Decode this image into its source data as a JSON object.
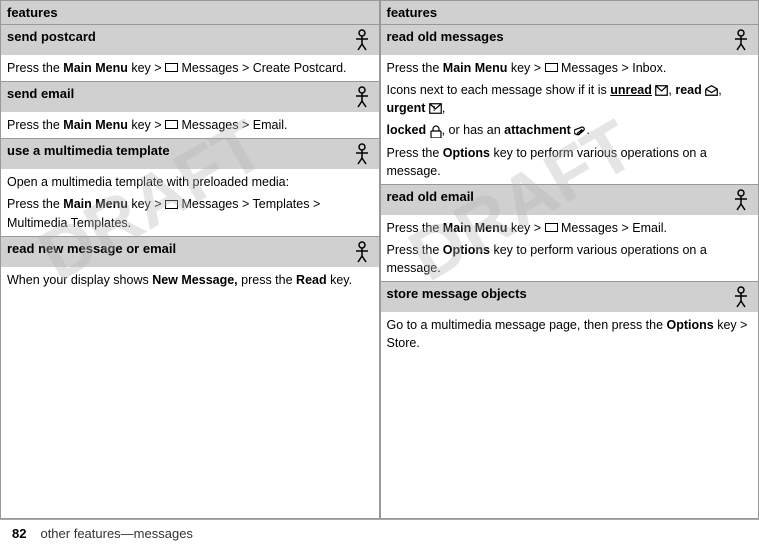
{
  "footer": {
    "page_number": "82",
    "page_text": "other features—messages"
  },
  "columns": [
    {
      "header": "features",
      "sections": [
        {
          "type": "header",
          "title": "send postcard",
          "has_icon": true,
          "body": [
            {
              "type": "text_with_bold",
              "parts": [
                {
                  "text": "Press the ",
                  "bold": false
                },
                {
                  "text": "Main Menu",
                  "bold": true
                },
                {
                  "text": " key > ",
                  "bold": false
                },
                {
                  "text": "M",
                  "bold": false,
                  "icon": "envelope"
                },
                {
                  "text": " Messages > Create Postcard.",
                  "bold": false
                }
              ]
            }
          ]
        },
        {
          "type": "header",
          "title": "send email",
          "has_icon": true,
          "body": [
            {
              "type": "text_with_bold",
              "parts": [
                {
                  "text": "Press the ",
                  "bold": false
                },
                {
                  "text": "Main Menu",
                  "bold": true
                },
                {
                  "text": " key > ",
                  "bold": false
                },
                {
                  "text": "M",
                  "bold": false,
                  "icon": "envelope"
                },
                {
                  "text": " Messages > Email.",
                  "bold": false
                }
              ]
            }
          ]
        },
        {
          "type": "header",
          "title": "use a multimedia template",
          "has_icon": true,
          "body": [
            {
              "type": "plain",
              "text": "Open a multimedia template with preloaded media:"
            },
            {
              "type": "text_with_bold",
              "parts": [
                {
                  "text": "Press the ",
                  "bold": false
                },
                {
                  "text": "Main Menu",
                  "bold": true
                },
                {
                  "text": " key > ",
                  "bold": false
                },
                {
                  "text": "M",
                  "bold": false,
                  "icon": "envelope"
                },
                {
                  "text": " Messages > Templates > Multimedia Templates.",
                  "bold": false
                }
              ]
            }
          ]
        },
        {
          "type": "header",
          "title": "read new message or email",
          "has_icon": true,
          "body": [
            {
              "type": "text_with_bold",
              "parts": [
                {
                  "text": "When your display shows ",
                  "bold": false
                },
                {
                  "text": "New Message,",
                  "bold": true
                },
                {
                  "text": " press the ",
                  "bold": false
                },
                {
                  "text": "Read",
                  "bold": true
                },
                {
                  "text": " key.",
                  "bold": false
                }
              ]
            }
          ]
        }
      ]
    },
    {
      "header": "features",
      "sections": [
        {
          "type": "header",
          "title": "read old messages",
          "has_icon": true,
          "body": [
            {
              "type": "text_with_bold",
              "parts": [
                {
                  "text": "Press the ",
                  "bold": false
                },
                {
                  "text": "Main Menu",
                  "bold": true
                },
                {
                  "text": " key > ",
                  "bold": false
                },
                {
                  "text": "M",
                  "bold": false,
                  "icon": "envelope"
                },
                {
                  "text": " Messages > Inbox.",
                  "bold": false
                }
              ]
            },
            {
              "type": "mixed_icons",
              "content": "icons_msg_row"
            }
          ]
        },
        {
          "type": "header",
          "title": "read old email",
          "has_icon": true,
          "body": [
            {
              "type": "text_with_bold",
              "parts": [
                {
                  "text": "Press the ",
                  "bold": false
                },
                {
                  "text": "Main Menu",
                  "bold": true
                },
                {
                  "text": " key > ",
                  "bold": false
                },
                {
                  "text": "M",
                  "bold": false,
                  "icon": "envelope"
                },
                {
                  "text": " Messages > Email.",
                  "bold": false
                }
              ]
            },
            {
              "type": "text_with_bold",
              "parts": [
                {
                  "text": "Press the ",
                  "bold": false
                },
                {
                  "text": "Options",
                  "bold": true
                },
                {
                  "text": " key to perform various operations on a message.",
                  "bold": false
                }
              ]
            }
          ]
        },
        {
          "type": "header",
          "title": "store message objects",
          "has_icon": true,
          "body": [
            {
              "type": "text_with_bold",
              "parts": [
                {
                  "text": "Go to a multimedia message page, then press the ",
                  "bold": false
                },
                {
                  "text": "Options",
                  "bold": true
                },
                {
                  "text": " key > Store.",
                  "bold": false
                }
              ]
            }
          ]
        }
      ]
    }
  ]
}
